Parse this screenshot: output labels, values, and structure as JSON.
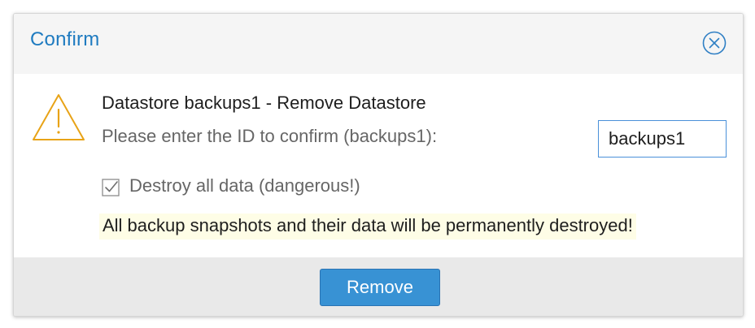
{
  "dialog": {
    "title": "Confirm",
    "close_icon": "close-circle-icon",
    "warning_icon": "warning-triangle-icon",
    "heading": "Datastore backups1 - Remove Datastore",
    "prompt": "Please enter the ID to confirm (backups1):",
    "id_input_value": "backups1",
    "checkbox": {
      "label": "Destroy all data (dangerous!)",
      "checked": true
    },
    "danger_message": "All backup snapshots and their data will be permanently destroyed!",
    "remove_label": "Remove"
  },
  "colors": {
    "title": "#1f7bc0",
    "warning": "#e8a317",
    "button": "#3892d4",
    "highlight": "#fefde6"
  }
}
